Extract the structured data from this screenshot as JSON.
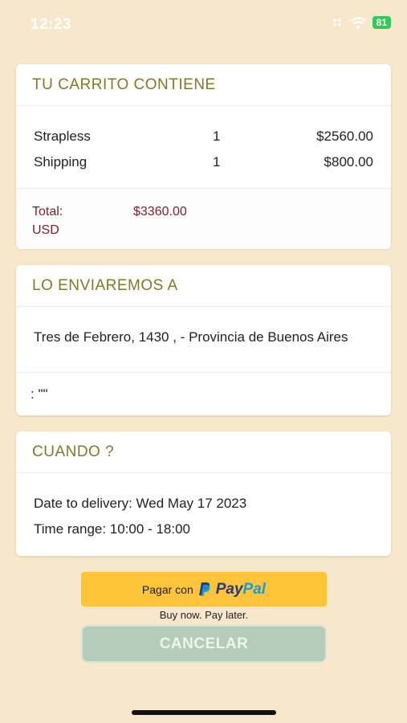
{
  "status_bar": {
    "time": "12:23",
    "battery": "81"
  },
  "cart": {
    "title": "TU CARRITO CONTIENE",
    "items": [
      {
        "name": "Strapless",
        "qty": "1",
        "price": "$2560.00"
      },
      {
        "name": "Shipping",
        "qty": "1",
        "price": "$800.00"
      }
    ],
    "total_label_line1": "Total:",
    "total_label_line2": "USD",
    "total_value": "$3360.00"
  },
  "shipping": {
    "title": "LO ENVIAREMOS A",
    "address": "Tres de Febrero, 1430 , - Provincia de Buenos Aires",
    "note": ": \"\""
  },
  "when": {
    "title": "CUANDO ?",
    "date_line": "Date to delivery: Wed May 17 2023",
    "time_line": "Time range: 10:00 - 18:00"
  },
  "paypal": {
    "prefix": "Pagar con",
    "brand_pay": "Pay",
    "brand_pal": "Pal",
    "tagline": "Buy now. Pay later."
  },
  "cancel_label": "CANCELAR"
}
